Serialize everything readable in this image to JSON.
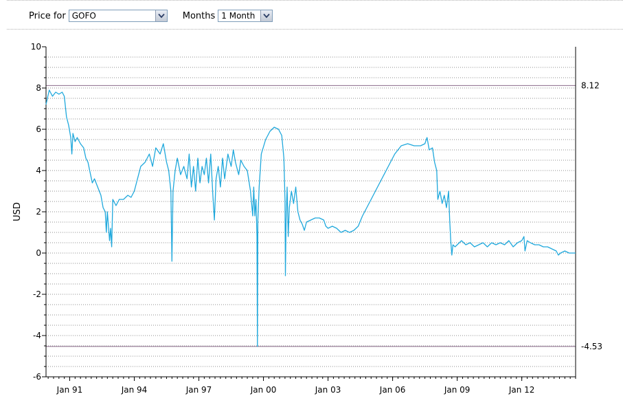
{
  "controls": {
    "price_label": "Price for",
    "price_value": "GOFO",
    "months_label": "Months",
    "months_value": "1 Month"
  },
  "colors": {
    "line": "#1fa8dc",
    "ref_line": "#8a6a8a",
    "grid": "#8c8c8c"
  },
  "icons": {
    "dropdown": "chevron-down-icon"
  },
  "chart_data": {
    "type": "line",
    "ylabel": "USD",
    "xlabel": "",
    "ylim": [
      -6,
      10
    ],
    "xlim": [
      1989.9,
      2014.5
    ],
    "y_ticks": [
      -6,
      -4,
      -2,
      0,
      2,
      4,
      6,
      8,
      10
    ],
    "x_ticks": [
      {
        "value": 1991.0,
        "label": "Jan 91"
      },
      {
        "value": 1994.0,
        "label": "Jan 94"
      },
      {
        "value": 1997.0,
        "label": "Jan 97"
      },
      {
        "value": 2000.0,
        "label": "Jan 00"
      },
      {
        "value": 2003.0,
        "label": "Jan 03"
      },
      {
        "value": 2006.0,
        "label": "Jan 06"
      },
      {
        "value": 2009.0,
        "label": "Jan 09"
      },
      {
        "value": 2012.0,
        "label": "Jan 12"
      }
    ],
    "grid": true,
    "reference_lines": [
      {
        "value": 8.12,
        "label": "8.12"
      },
      {
        "value": -4.53,
        "label": "-4.53"
      }
    ],
    "series": [
      {
        "name": "",
        "points": [
          [
            1989.9,
            7.2
          ],
          [
            1990.05,
            7.9
          ],
          [
            1990.2,
            7.6
          ],
          [
            1990.35,
            7.8
          ],
          [
            1990.5,
            7.7
          ],
          [
            1990.65,
            7.8
          ],
          [
            1990.75,
            7.6
          ],
          [
            1990.85,
            6.6
          ],
          [
            1990.95,
            6.2
          ],
          [
            1991.05,
            5.6
          ],
          [
            1991.1,
            4.8
          ],
          [
            1991.15,
            5.8
          ],
          [
            1991.25,
            5.4
          ],
          [
            1991.35,
            5.6
          ],
          [
            1991.5,
            5.3
          ],
          [
            1991.65,
            5.1
          ],
          [
            1991.75,
            4.6
          ],
          [
            1991.85,
            4.4
          ],
          [
            1991.95,
            3.9
          ],
          [
            1992.05,
            3.4
          ],
          [
            1992.15,
            3.6
          ],
          [
            1992.3,
            3.2
          ],
          [
            1992.45,
            2.8
          ],
          [
            1992.55,
            2.2
          ],
          [
            1992.65,
            2.0
          ],
          [
            1992.7,
            1.0
          ],
          [
            1992.75,
            2.0
          ],
          [
            1992.85,
            0.6
          ],
          [
            1992.9,
            1.2
          ],
          [
            1992.95,
            0.3
          ],
          [
            1993.0,
            2.6
          ],
          [
            1993.15,
            2.3
          ],
          [
            1993.3,
            2.6
          ],
          [
            1993.5,
            2.6
          ],
          [
            1993.7,
            2.8
          ],
          [
            1993.85,
            2.7
          ],
          [
            1994.0,
            3.0
          ],
          [
            1994.15,
            3.6
          ],
          [
            1994.3,
            4.2
          ],
          [
            1994.5,
            4.4
          ],
          [
            1994.7,
            4.8
          ],
          [
            1994.85,
            4.2
          ],
          [
            1995.0,
            5.1
          ],
          [
            1995.2,
            4.8
          ],
          [
            1995.35,
            5.3
          ],
          [
            1995.5,
            4.4
          ],
          [
            1995.6,
            4.0
          ],
          [
            1995.7,
            3.0
          ],
          [
            1995.75,
            -0.4
          ],
          [
            1995.8,
            3.0
          ],
          [
            1995.9,
            4.0
          ],
          [
            1996.0,
            4.6
          ],
          [
            1996.15,
            3.8
          ],
          [
            1996.3,
            4.2
          ],
          [
            1996.45,
            3.6
          ],
          [
            1996.55,
            4.8
          ],
          [
            1996.65,
            3.2
          ],
          [
            1996.75,
            4.2
          ],
          [
            1996.85,
            3.0
          ],
          [
            1996.95,
            4.6
          ],
          [
            1997.05,
            3.4
          ],
          [
            1997.15,
            4.2
          ],
          [
            1997.25,
            3.8
          ],
          [
            1997.35,
            4.6
          ],
          [
            1997.45,
            3.4
          ],
          [
            1997.55,
            4.8
          ],
          [
            1997.65,
            2.8
          ],
          [
            1997.72,
            1.6
          ],
          [
            1997.8,
            3.6
          ],
          [
            1997.9,
            4.2
          ],
          [
            1998.0,
            3.2
          ],
          [
            1998.1,
            4.6
          ],
          [
            1998.2,
            3.6
          ],
          [
            1998.35,
            4.8
          ],
          [
            1998.5,
            4.2
          ],
          [
            1998.6,
            5.0
          ],
          [
            1998.7,
            4.4
          ],
          [
            1998.85,
            3.8
          ],
          [
            1998.95,
            4.5
          ],
          [
            1999.1,
            4.2
          ],
          [
            1999.25,
            4.0
          ],
          [
            1999.4,
            3.0
          ],
          [
            1999.5,
            1.8
          ],
          [
            1999.55,
            3.2
          ],
          [
            1999.6,
            1.8
          ],
          [
            1999.65,
            2.6
          ],
          [
            1999.7,
            0.8
          ],
          [
            1999.72,
            -4.53
          ],
          [
            1999.74,
            1.6
          ],
          [
            1999.8,
            3.2
          ],
          [
            1999.9,
            4.8
          ],
          [
            2000.1,
            5.5
          ],
          [
            2000.3,
            5.9
          ],
          [
            2000.5,
            6.1
          ],
          [
            2000.7,
            6.0
          ],
          [
            2000.85,
            5.7
          ],
          [
            2000.95,
            4.6
          ],
          [
            2001.0,
            2.6
          ],
          [
            2001.02,
            -1.1
          ],
          [
            2001.05,
            1.6
          ],
          [
            2001.1,
            3.2
          ],
          [
            2001.15,
            0.8
          ],
          [
            2001.2,
            2.2
          ],
          [
            2001.3,
            3.0
          ],
          [
            2001.4,
            2.4
          ],
          [
            2001.5,
            3.2
          ],
          [
            2001.55,
            2.6
          ],
          [
            2001.6,
            2.0
          ],
          [
            2001.7,
            1.6
          ],
          [
            2001.8,
            1.4
          ],
          [
            2001.9,
            1.1
          ],
          [
            2002.0,
            1.5
          ],
          [
            2002.2,
            1.6
          ],
          [
            2002.4,
            1.7
          ],
          [
            2002.6,
            1.7
          ],
          [
            2002.8,
            1.6
          ],
          [
            2002.9,
            1.3
          ],
          [
            2003.0,
            1.2
          ],
          [
            2003.2,
            1.3
          ],
          [
            2003.4,
            1.2
          ],
          [
            2003.6,
            1.0
          ],
          [
            2003.8,
            1.1
          ],
          [
            2004.0,
            1.0
          ],
          [
            2004.2,
            1.1
          ],
          [
            2004.4,
            1.3
          ],
          [
            2004.6,
            1.8
          ],
          [
            2004.8,
            2.2
          ],
          [
            2005.0,
            2.6
          ],
          [
            2005.2,
            3.0
          ],
          [
            2005.5,
            3.6
          ],
          [
            2005.8,
            4.2
          ],
          [
            2006.1,
            4.8
          ],
          [
            2006.4,
            5.2
          ],
          [
            2006.7,
            5.3
          ],
          [
            2007.0,
            5.2
          ],
          [
            2007.3,
            5.2
          ],
          [
            2007.5,
            5.3
          ],
          [
            2007.6,
            5.6
          ],
          [
            2007.7,
            5.0
          ],
          [
            2007.85,
            5.1
          ],
          [
            2007.95,
            4.4
          ],
          [
            2008.05,
            4.0
          ],
          [
            2008.1,
            2.6
          ],
          [
            2008.2,
            3.0
          ],
          [
            2008.3,
            2.4
          ],
          [
            2008.4,
            2.8
          ],
          [
            2008.5,
            2.2
          ],
          [
            2008.6,
            3.0
          ],
          [
            2008.65,
            1.6
          ],
          [
            2008.7,
            0.6
          ],
          [
            2008.75,
            -0.1
          ],
          [
            2008.8,
            0.4
          ],
          [
            2008.9,
            0.3
          ],
          [
            2009.0,
            0.4
          ],
          [
            2009.2,
            0.6
          ],
          [
            2009.4,
            0.4
          ],
          [
            2009.6,
            0.5
          ],
          [
            2009.8,
            0.3
          ],
          [
            2010.0,
            0.4
          ],
          [
            2010.2,
            0.5
          ],
          [
            2010.4,
            0.3
          ],
          [
            2010.6,
            0.5
          ],
          [
            2010.8,
            0.4
          ],
          [
            2011.0,
            0.5
          ],
          [
            2011.2,
            0.4
          ],
          [
            2011.4,
            0.6
          ],
          [
            2011.6,
            0.3
          ],
          [
            2011.8,
            0.5
          ],
          [
            2012.0,
            0.6
          ],
          [
            2012.1,
            0.8
          ],
          [
            2012.15,
            0.1
          ],
          [
            2012.25,
            0.6
          ],
          [
            2012.4,
            0.5
          ],
          [
            2012.6,
            0.4
          ],
          [
            2012.8,
            0.4
          ],
          [
            2013.0,
            0.3
          ],
          [
            2013.2,
            0.3
          ],
          [
            2013.4,
            0.2
          ],
          [
            2013.6,
            0.1
          ],
          [
            2013.7,
            -0.1
          ],
          [
            2013.8,
            0.0
          ],
          [
            2014.0,
            0.1
          ],
          [
            2014.2,
            0.0
          ],
          [
            2014.4,
            0.0
          ],
          [
            2014.5,
            0.0
          ]
        ]
      }
    ]
  }
}
